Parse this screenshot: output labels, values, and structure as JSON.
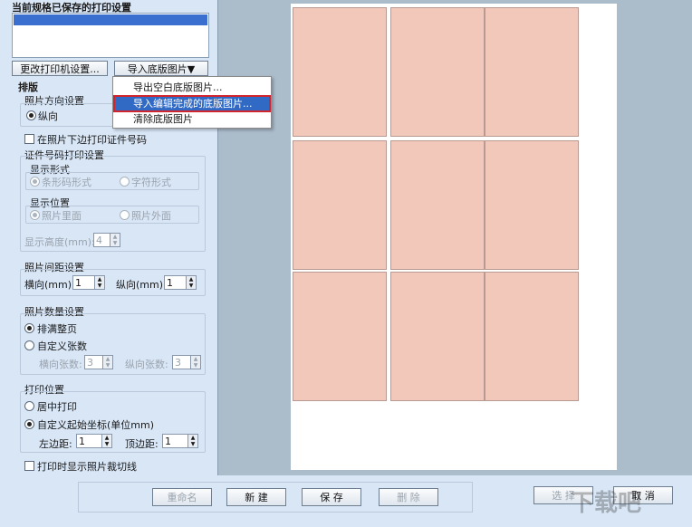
{
  "left": {
    "title": "当前规格已保存的打印设置",
    "change_printer_btn": "更改打印机设置...",
    "import_bg_btn": "导入底版图片▼",
    "layout_label": "排版",
    "orientation_group": "照片方向设置",
    "orientation_portrait": "纵向",
    "print_id_under_photo": "在照片下边打印证件号码",
    "id_print_group": "证件号码打印设置",
    "display_form": "显示形式",
    "barcode_form": "条形码形式",
    "char_form": "字符形式",
    "display_pos": "显示位置",
    "inside_photo": "照片里面",
    "outside_photo": "照片外面",
    "display_height": "显示高度(mm):",
    "display_height_val": "4",
    "spacing_group": "照片间距设置",
    "horiz_mm": "横向(mm):",
    "horiz_val": "1",
    "vert_mm": "纵向(mm):",
    "vert_val": "1",
    "count_group": "照片数量设置",
    "fill_page": "排满整页",
    "custom_count": "自定义张数",
    "horiz_count": "横向张数:",
    "horiz_count_val": "3",
    "vert_count": "纵向张数:",
    "vert_count_val": "3",
    "position_group": "打印位置",
    "center_print": "居中打印",
    "custom_origin": "自定义起始坐标(单位mm)",
    "left_margin": "左边距:",
    "left_margin_val": "1",
    "top_margin": "顶边距:",
    "top_margin_val": "1",
    "show_cut_lines": "打印时显示照片裁切线"
  },
  "menu": {
    "items": [
      "导出空白底版图片...",
      "导入编辑完成的底版图片...",
      "清除底版图片"
    ]
  },
  "bottom": {
    "rename": "重命名",
    "new": "新 建",
    "save": "保 存",
    "delete": "删 除",
    "select": "选 择",
    "cancel": "取 消"
  },
  "watermark": "下载吧"
}
